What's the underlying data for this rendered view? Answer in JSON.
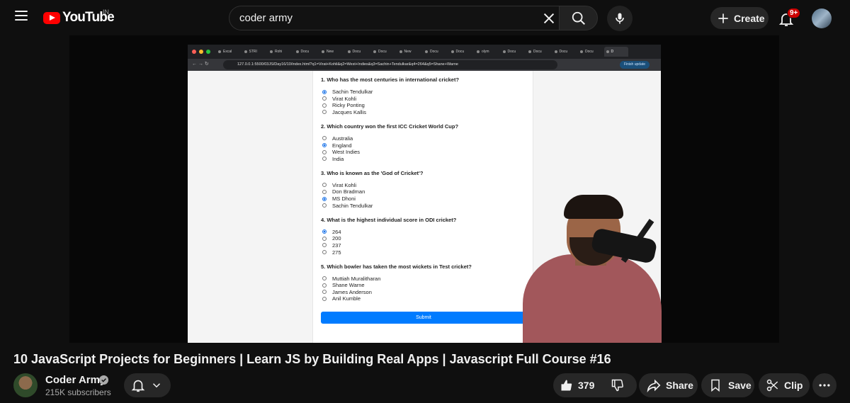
{
  "header": {
    "logo_text": "YouTube",
    "country_code": "IN",
    "search_value": "coder army",
    "search_placeholder": "Search",
    "create_label": "Create",
    "notification_badge": "9+"
  },
  "video": {
    "browser_tabs": [
      "Excal",
      "STRI",
      "Rohi",
      "Docu",
      "New",
      "Docu",
      "Docu",
      "New",
      "Docu",
      "Docu",
      "olym",
      "Docu",
      "Docu",
      "Docu",
      "Docu",
      "D"
    ],
    "url": "127.0.0.1:5500/03JS/Day16/10/index.html?q1=Virat+Kohli&q2=West+Indies&q3=Sachin+Tendulkar&q4=264&q5=Shane+Warne",
    "finish_update": "Finish update",
    "quiz": [
      {
        "q": "1. Who has the most centuries in international cricket?",
        "options": [
          "Sachin Tendulkar",
          "Virat Kohli",
          "Ricky Ponting",
          "Jacques Kallis"
        ],
        "selected": 0
      },
      {
        "q": "2. Which country won the first ICC Cricket World Cup?",
        "options": [
          "Australia",
          "England",
          "West Indies",
          "India"
        ],
        "selected": 1
      },
      {
        "q": "3. Who is known as the 'God of Cricket'?",
        "options": [
          "Virat Kohli",
          "Don Bradman",
          "MS Dhoni",
          "Sachin Tendulkar"
        ],
        "selected": 2
      },
      {
        "q": "4. What is the highest individual score in ODI cricket?",
        "options": [
          "264",
          "200",
          "237",
          "275"
        ],
        "selected": 0
      },
      {
        "q": "5. Which bowler has taken the most wickets in Test cricket?",
        "options": [
          "Muttiah Muralitharan",
          "Shane Warne",
          "James Anderson",
          "Anil Kumble"
        ],
        "selected": -1
      }
    ],
    "submit_label": "Submit"
  },
  "info": {
    "title": "10 JavaScript Projects for Beginners | Learn JS by Building Real Apps | Javascript Full Course #16",
    "channel_name": "Coder Army",
    "subscribers": "215K subscribers",
    "likes": "379",
    "share_label": "Share",
    "save_label": "Save",
    "clip_label": "Clip"
  },
  "colors": {
    "brand": "#ff0000",
    "badge": "#cc0000",
    "submit": "#007bff"
  }
}
